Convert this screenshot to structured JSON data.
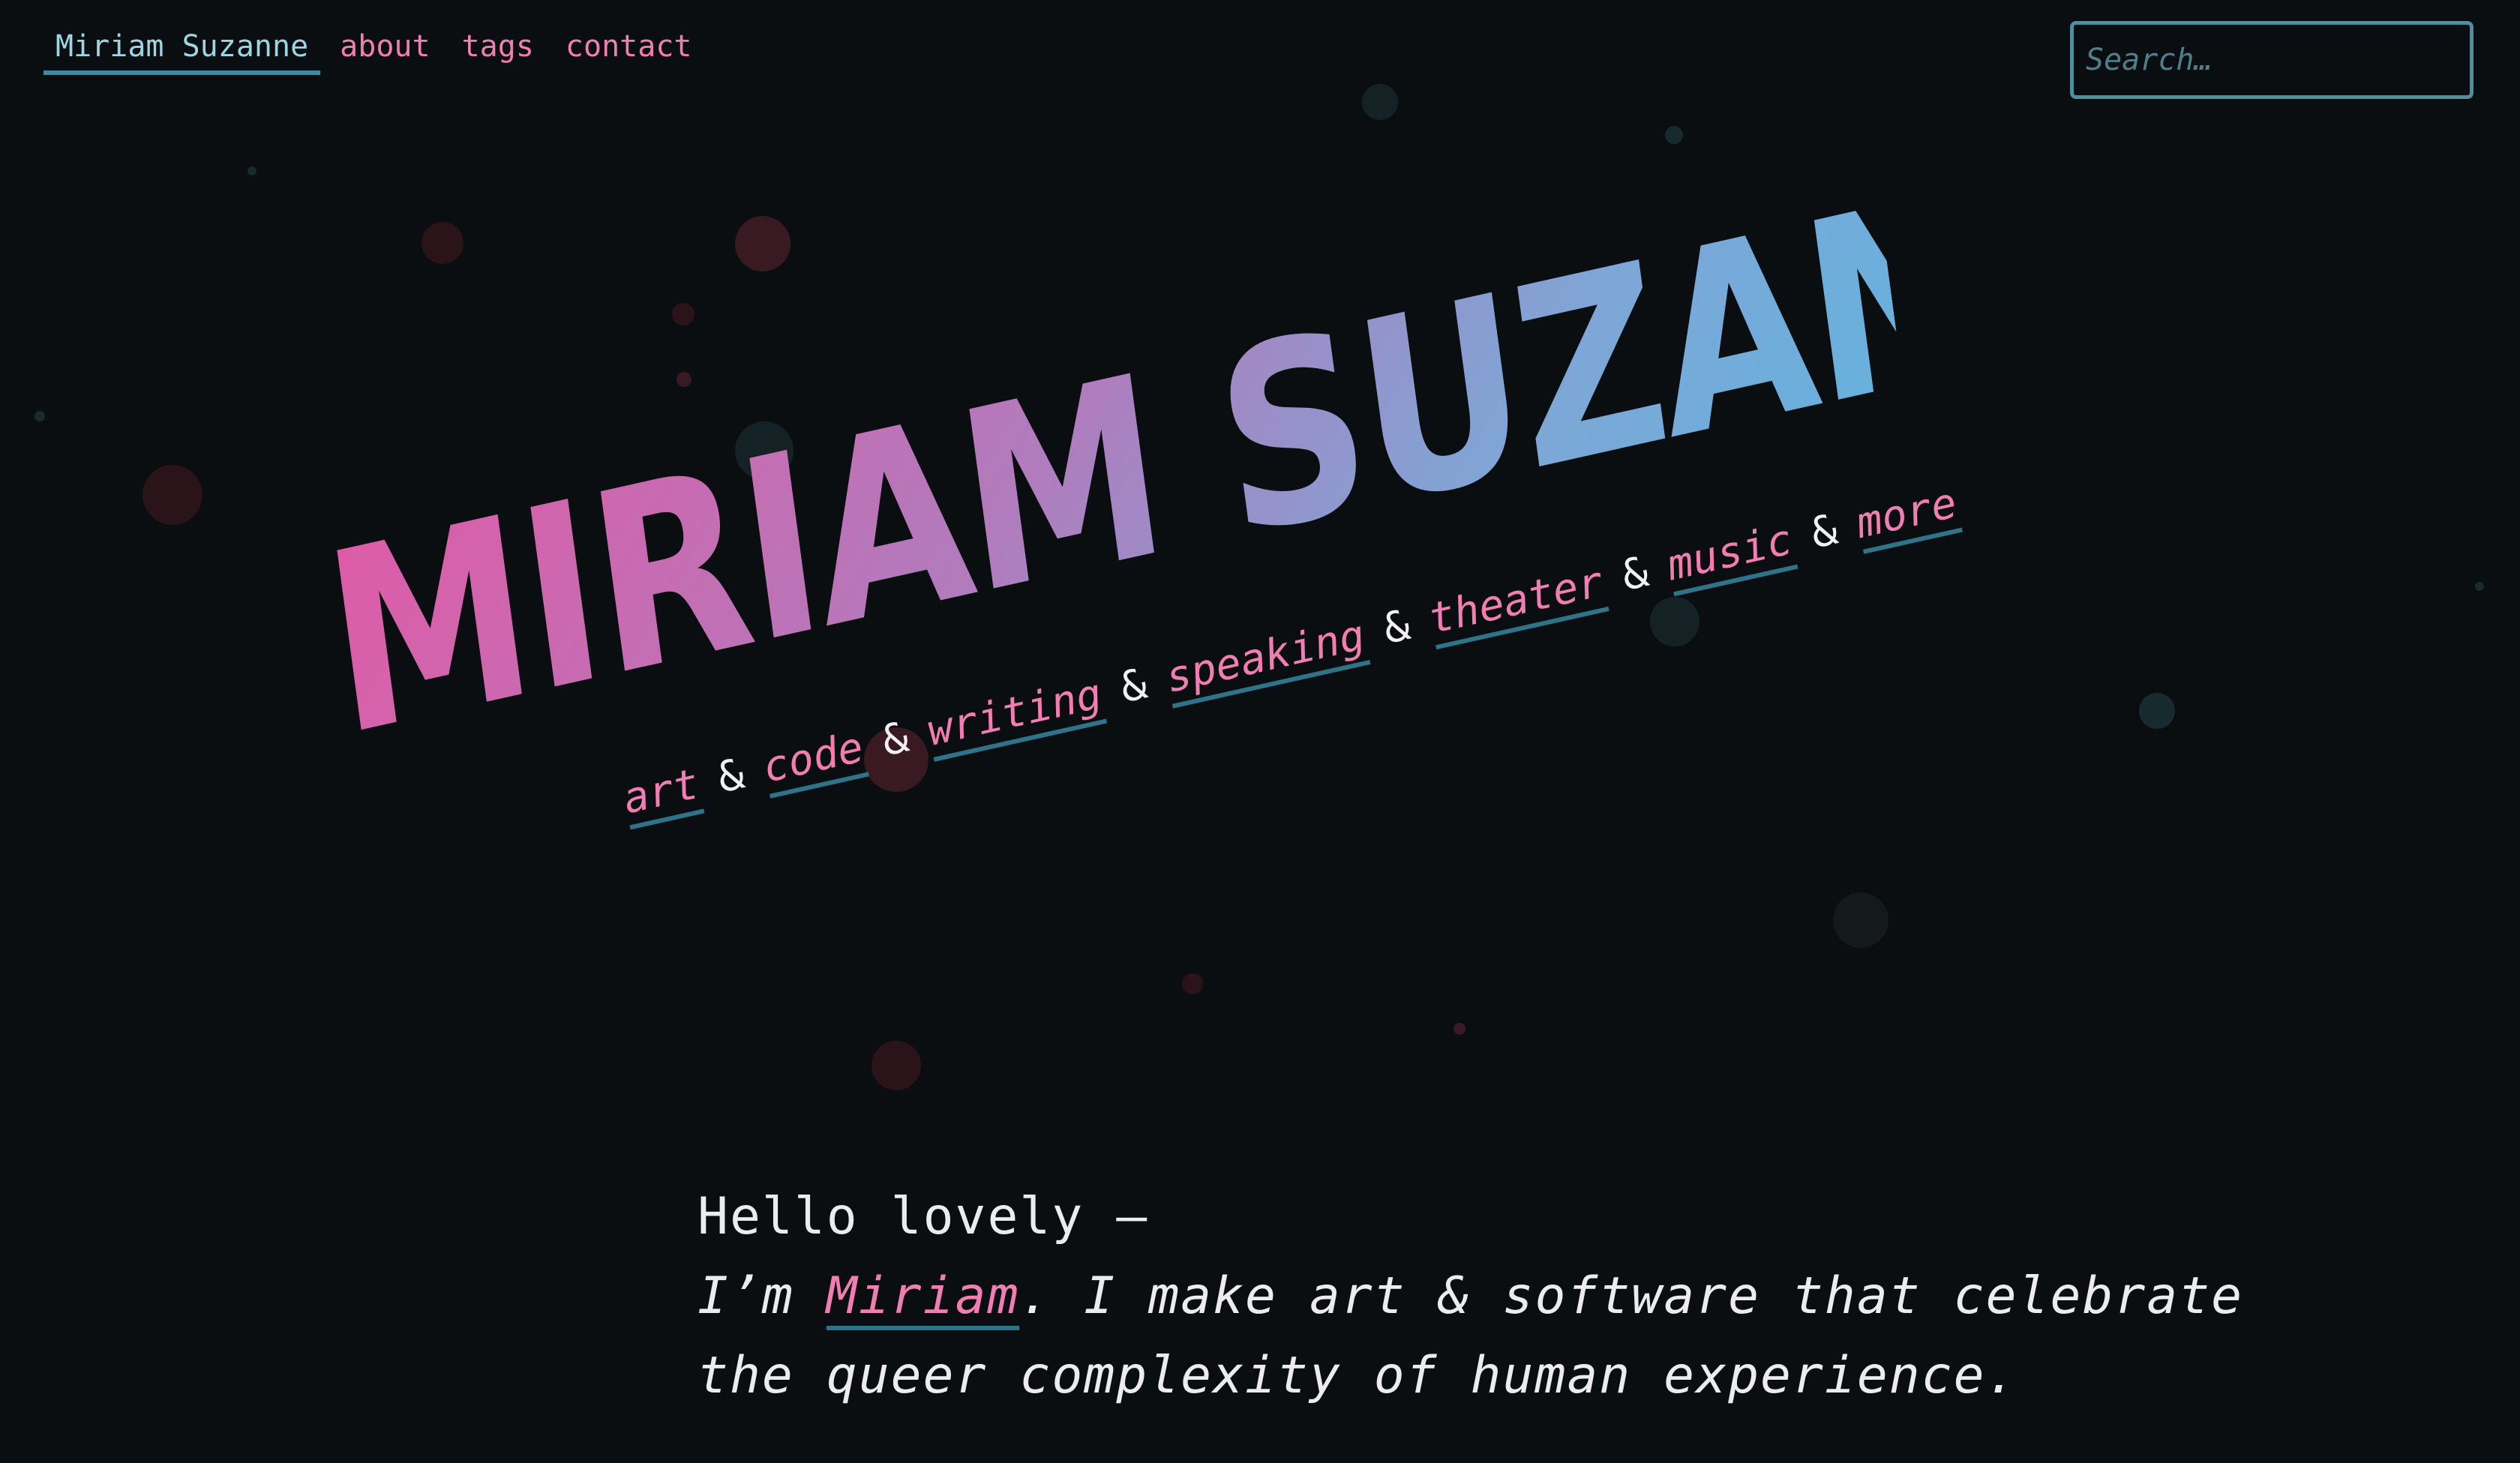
{
  "nav": {
    "items": [
      {
        "label": "Miriam Suzanne",
        "current": true
      },
      {
        "label": "about",
        "current": false
      },
      {
        "label": "tags",
        "current": false
      },
      {
        "label": "contact",
        "current": false
      }
    ]
  },
  "search": {
    "placeholder": "Search…",
    "value": ""
  },
  "hero": {
    "title": "Miriam Suzanne",
    "tagline": [
      "art",
      "code",
      "writing",
      "speaking",
      "theater",
      "music",
      "more"
    ],
    "separator": "&"
  },
  "intro": {
    "greeting": "Hello lovely —",
    "prefix": "I’m ",
    "name_link": "Miriam",
    "line1_rest": ". I make art & software that celebrate",
    "line2": "the queer complexity of human experience."
  },
  "colors": {
    "background": "#0b0e10",
    "link_pink": "#f07eb2",
    "accent_teal": "#3b8aa3",
    "nav_current": "#9ed5e3",
    "gradient_start": "#e05aa6",
    "gradient_end": "#64b2de"
  }
}
